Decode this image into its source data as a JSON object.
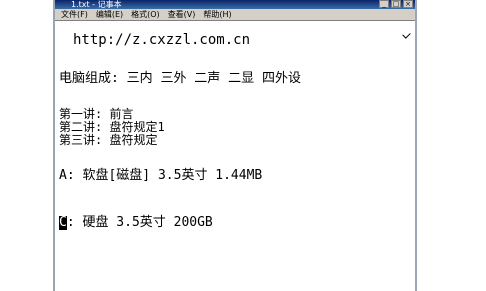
{
  "window": {
    "title": "1.txt - 记事本",
    "minimize": "_",
    "maximize": "□",
    "close": "×"
  },
  "menu": [
    "文件(F)",
    "编辑(E)",
    "格式(O)",
    "查看(V)",
    "帮助(H)"
  ],
  "document": {
    "url": "http://z.cxzzl.com.cn",
    "composition": "电脑组成: 三内 三外 二声 二显 四外设",
    "lecture1": "第一讲: 前言",
    "lecture2": "第二讲: 盘符规定1",
    "lecture3": "第三讲: 盘符规定",
    "drive_a": "A: 软盘[磁盘] 3.5英寸 1.44MB",
    "drive_c_letter": "C",
    "drive_c_rest": ": 硬盘 3.5英寸 200GB"
  }
}
